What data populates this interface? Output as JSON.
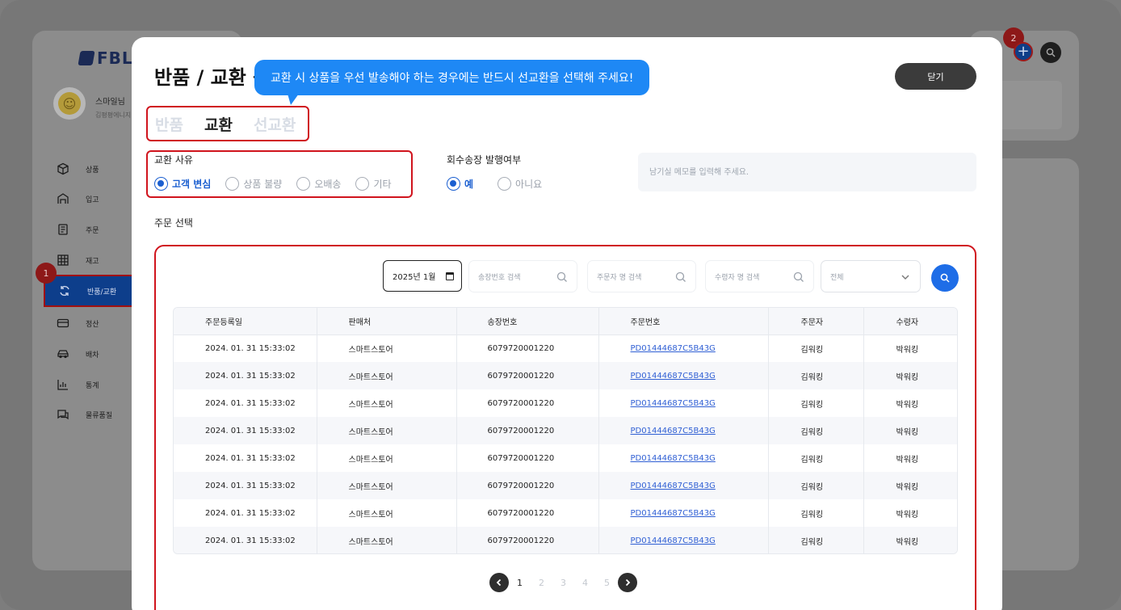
{
  "app": {
    "logo_text": "FBL",
    "user_name": "스마일님",
    "user_sub": "김평평에니지",
    "nav": [
      {
        "label": "상품",
        "icon": "box-icon"
      },
      {
        "label": "입고",
        "icon": "warehouse-icon"
      },
      {
        "label": "주문",
        "icon": "order-list-icon"
      },
      {
        "label": "재고",
        "icon": "grid-icon"
      },
      {
        "label": "반품/교환",
        "icon": "refresh-icon"
      },
      {
        "label": "정산",
        "icon": "card-icon"
      },
      {
        "label": "배차",
        "icon": "car-icon"
      },
      {
        "label": "통계",
        "icon": "chart-icon"
      },
      {
        "label": "물류품질",
        "icon": "chat-icon"
      }
    ],
    "step_badge_1": "1",
    "step_badge_2": "2"
  },
  "modal": {
    "title": "반품 / 교환 등록",
    "tooltip": "교환 시 상품을 우선 발송해야 하는 경우에는 반드시 선교환을 선택해 주세요!",
    "close_label": "닫기",
    "tabs": [
      {
        "label": "반품",
        "active": false
      },
      {
        "label": "교환",
        "active": true
      },
      {
        "label": "선교환",
        "active": false
      }
    ],
    "reason": {
      "label": "교환 사유",
      "options": [
        {
          "label": "고객 변심",
          "checked": true
        },
        {
          "label": "상품 불량",
          "checked": false
        },
        {
          "label": "오배송",
          "checked": false
        },
        {
          "label": "기타",
          "checked": false
        }
      ]
    },
    "return_invoice": {
      "label": "회수송장 발행여부",
      "options": [
        {
          "label": "예",
          "checked": true
        },
        {
          "label": "아니요",
          "checked": false
        }
      ]
    },
    "memo_placeholder": "남기실 메모를 입력해 주세요.",
    "order_select_label": "주문 선택",
    "filters": {
      "date_value": "2025년 1월",
      "invoice_placeholder": "송장번호 검색",
      "orderer_placeholder": "주문자 명 검색",
      "receiver_placeholder": "수령자 명 검색",
      "select_value": "전체"
    },
    "table": {
      "headers": [
        "주문등록일",
        "판매처",
        "송장번호",
        "주문번호",
        "주문자",
        "수령자"
      ],
      "rows": [
        [
          "2024. 01. 31 15:33:02",
          "스마트스토어",
          "6079720001220",
          "PD01444687C5B43G",
          "김워킹",
          "박워킹"
        ],
        [
          "2024. 01. 31 15:33:02",
          "스마트스토어",
          "6079720001220",
          "PD01444687C5B43G",
          "김워킹",
          "박워킹"
        ],
        [
          "2024. 01. 31 15:33:02",
          "스마트스토어",
          "6079720001220",
          "PD01444687C5B43G",
          "김워킹",
          "박워킹"
        ],
        [
          "2024. 01. 31 15:33:02",
          "스마트스토어",
          "6079720001220",
          "PD01444687C5B43G",
          "김워킹",
          "박워킹"
        ],
        [
          "2024. 01. 31 15:33:02",
          "스마트스토어",
          "6079720001220",
          "PD01444687C5B43G",
          "김워킹",
          "박워킹"
        ],
        [
          "2024. 01. 31 15:33:02",
          "스마트스토어",
          "6079720001220",
          "PD01444687C5B43G",
          "김워킹",
          "박워킹"
        ],
        [
          "2024. 01. 31 15:33:02",
          "스마트스토어",
          "6079720001220",
          "PD01444687C5B43G",
          "김워킹",
          "박워킹"
        ],
        [
          "2024. 01. 31 15:33:02",
          "스마트스토어",
          "6079720001220",
          "PD01444687C5B43G",
          "김워킹",
          "박워킹"
        ]
      ]
    },
    "pagination": {
      "pages": [
        "1",
        "2",
        "3",
        "4",
        "5"
      ],
      "current": "1"
    }
  },
  "colors": {
    "accent": "#1e6de7",
    "tooltip": "#1e88f5",
    "highlight_border": "#d0141d",
    "link": "#2f5fd4"
  }
}
